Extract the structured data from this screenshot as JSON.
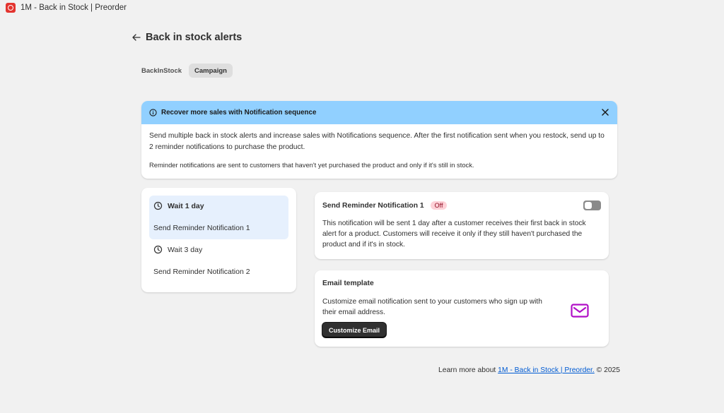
{
  "app": {
    "title": "1M - Back in Stock | Preorder"
  },
  "header": {
    "title": "Back in stock alerts"
  },
  "tabs": [
    {
      "label": "BackInStock"
    },
    {
      "label": "Campaign"
    }
  ],
  "banner": {
    "title": "Recover more sales with Notification sequence",
    "text": "Send multiple back in stock alerts and increase sales with Notifications sequence. After the first notification sent when you restock, send up to 2 reminder notifications to purchase the product.",
    "note": "Reminder notifications are sent to customers that haven't yet purchased the product and only if it's still in stock.",
    "accent": "#91d0ff"
  },
  "steps": [
    {
      "wait": "Wait 1 day",
      "name": "Send Reminder Notification 1"
    },
    {
      "wait": "Wait 3 day",
      "name": "Send Reminder Notification 2"
    }
  ],
  "notification": {
    "title": "Send Reminder Notification 1",
    "status": "Off",
    "description": "This notification will be sent 1 day after a customer receives their first back in stock alert for a product. Customers will receive it only if they still haven't purchased the product and if it's in stock."
  },
  "email": {
    "title": "Email template",
    "description": "Customize email notification sent to your customers who sign up with their email address.",
    "button": "Customize Email",
    "icon": "mail-icon",
    "icon_color": "#b10fc7"
  },
  "footer": {
    "prefix": "Learn more about",
    "link": "1M - Back in Stock | Preorder.",
    "suffix": "© 2025"
  }
}
